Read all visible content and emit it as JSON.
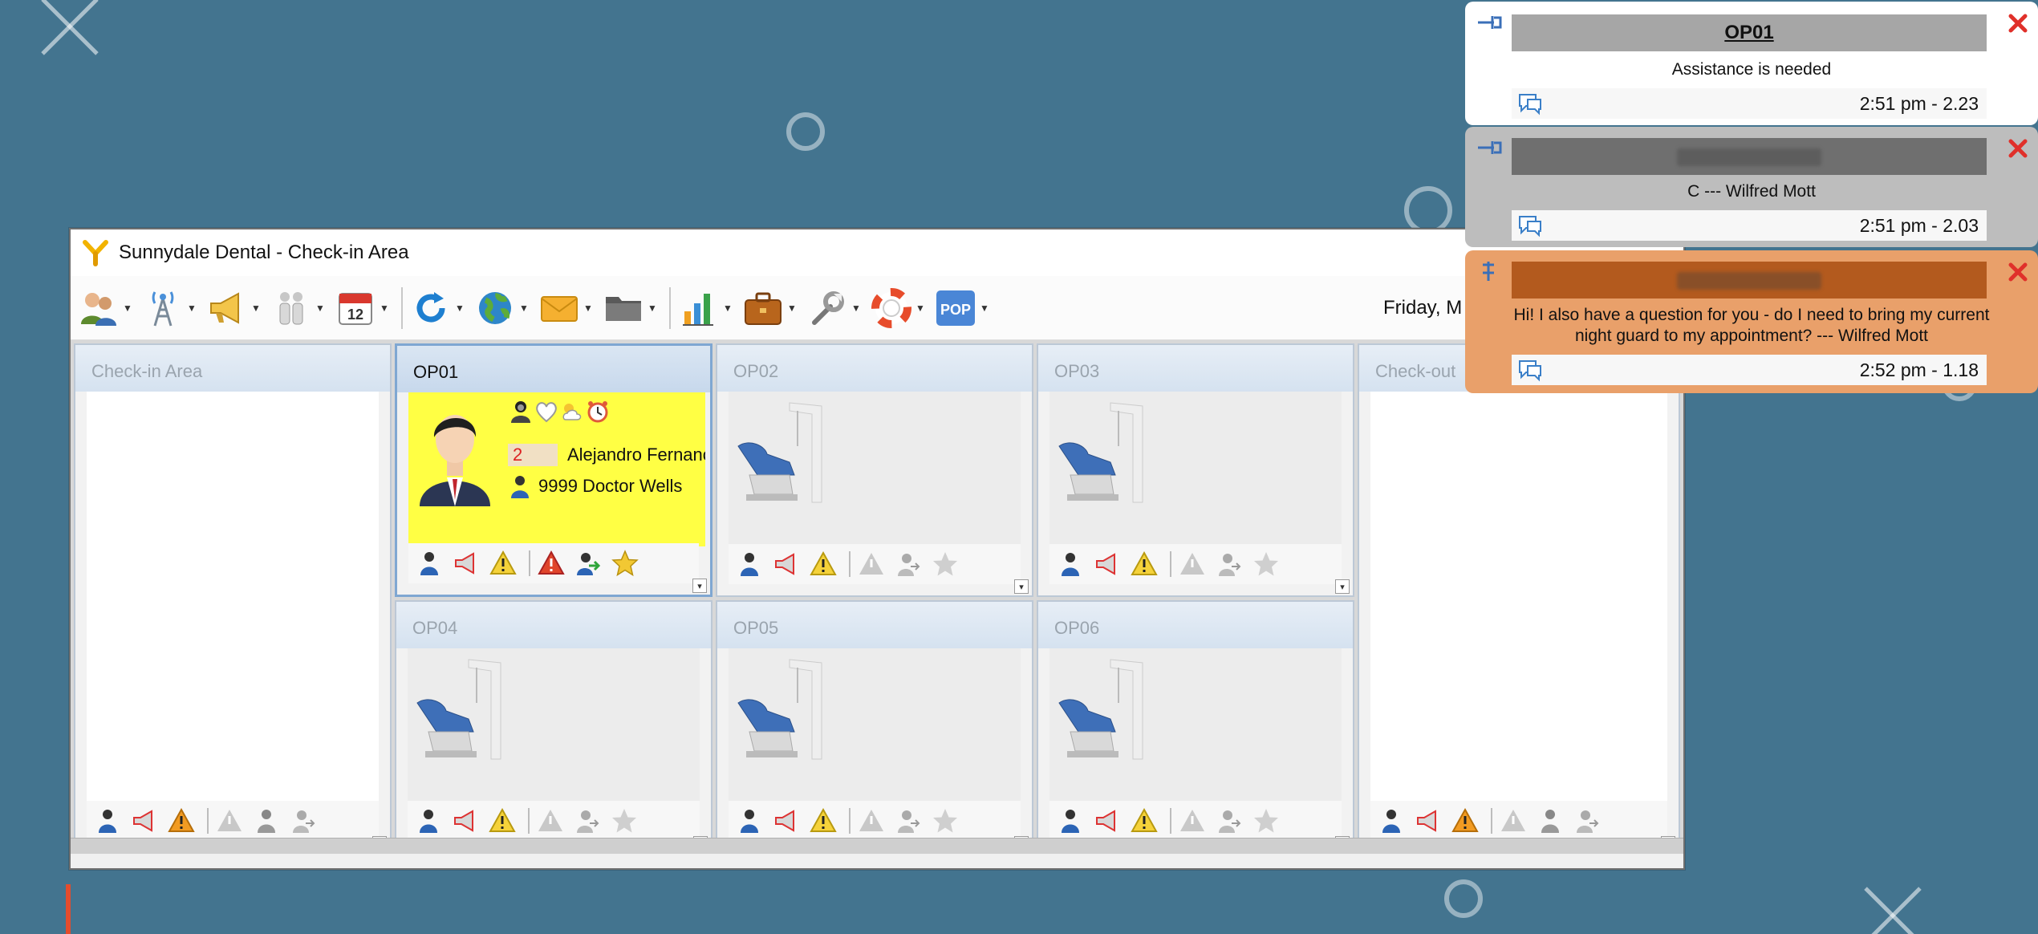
{
  "window": {
    "title": "Sunnydale Dental - Check-in Area",
    "date": "Friday, M"
  },
  "toolbar": {
    "buttons": [
      {
        "name": "patients-icon"
      },
      {
        "name": "broadcast-icon"
      },
      {
        "name": "megaphone-icon"
      },
      {
        "name": "staff-icon"
      },
      {
        "name": "calendar-icon",
        "label": "12"
      },
      {
        "name": "refresh-icon"
      },
      {
        "name": "globe-icon"
      },
      {
        "name": "mail-icon"
      },
      {
        "name": "folder-icon"
      },
      {
        "name": "chart-icon"
      },
      {
        "name": "briefcase-icon"
      },
      {
        "name": "tools-icon"
      },
      {
        "name": "help-icon"
      },
      {
        "name": "pop-icon",
        "label": "POP"
      }
    ]
  },
  "rooms": [
    {
      "id": "checkin",
      "label": "Check-in Area"
    },
    {
      "id": "op01",
      "label": "OP01"
    },
    {
      "id": "op02",
      "label": "OP02"
    },
    {
      "id": "op03",
      "label": "OP03"
    },
    {
      "id": "checkout",
      "label": "Check-out"
    },
    {
      "id": "op04",
      "label": "OP04"
    },
    {
      "id": "op05",
      "label": "OP05"
    },
    {
      "id": "op06",
      "label": "OP06"
    }
  ],
  "patient": {
    "number": "2",
    "name": "Alejandro Fernanc",
    "doctor": "9999 Doctor Wells"
  },
  "notifications": [
    {
      "title": "OP01",
      "message": "Assistance is needed",
      "time": "2:51 pm - 2.23",
      "color": "#ffffff"
    },
    {
      "title": "",
      "message": "C --- Wilfred Mott",
      "time": "2:51 pm - 2.03",
      "color": "#bdbdbd"
    },
    {
      "title": "",
      "message": "Hi! I also have a question for you - do I need to bring my current night guard to my appointment? --- Wilfred Mott",
      "time": "2:52 pm - 1.18",
      "color": "#e9a06a"
    }
  ]
}
